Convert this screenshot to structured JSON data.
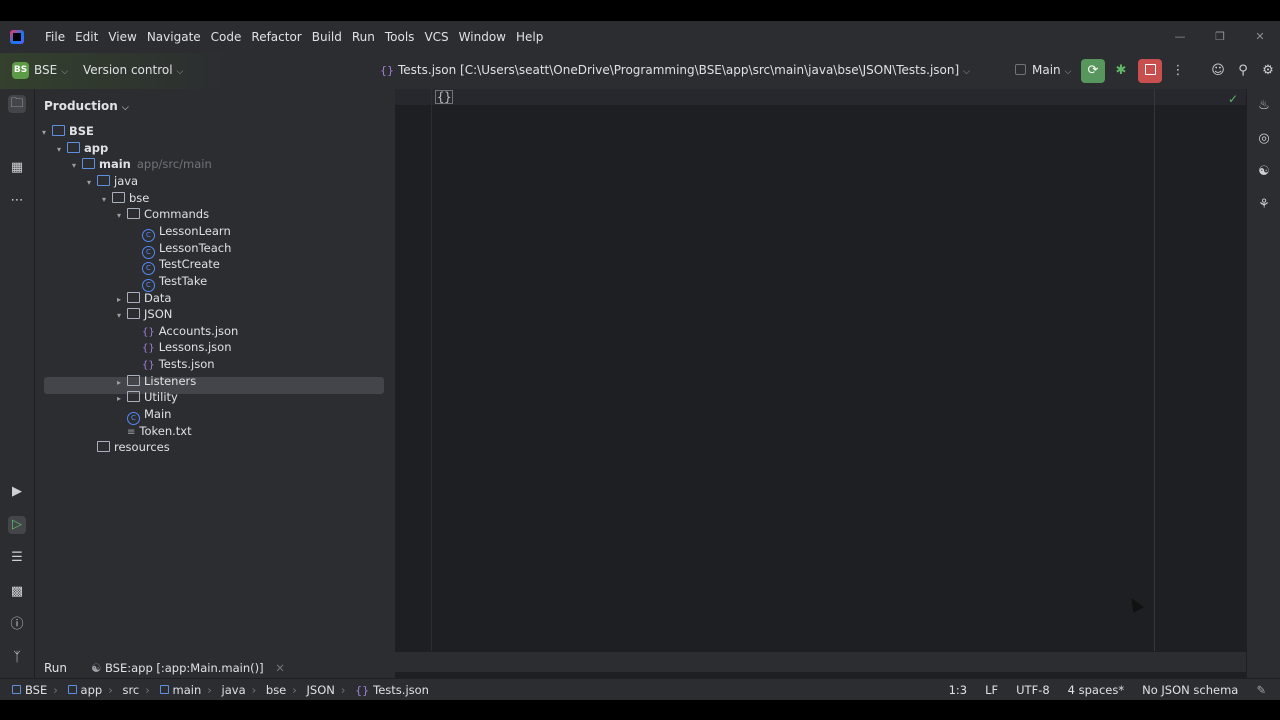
{
  "menu": [
    "File",
    "Edit",
    "View",
    "Navigate",
    "Code",
    "Refactor",
    "Build",
    "Run",
    "Tools",
    "VCS",
    "Window",
    "Help"
  ],
  "toolbar": {
    "project_badge": "BS",
    "project_name": "BSE",
    "vcs_label": "Version control",
    "file_title": "Tests.json [C:\\Users\\seatt\\OneDrive\\Programming\\BSE\\app\\src\\main\\java\\bse\\JSON\\Tests.json]",
    "run_config": "Main"
  },
  "panel": {
    "title": "Production"
  },
  "tree": [
    {
      "label": "BSE",
      "hint": "",
      "icon": "module-folder",
      "indent": 0,
      "arrow": "down",
      "bold": true
    },
    {
      "label": "app",
      "hint": "",
      "icon": "module-folder",
      "indent": 1,
      "arrow": "down",
      "bold": true
    },
    {
      "label": "main",
      "hint": "app/src/main",
      "icon": "module-folder",
      "indent": 2,
      "arrow": "down",
      "bold": true
    },
    {
      "label": "java",
      "hint": "",
      "icon": "source-folder",
      "indent": 3,
      "arrow": "down",
      "bold": false
    },
    {
      "label": "bse",
      "hint": "",
      "icon": "package",
      "indent": 4,
      "arrow": "down",
      "bold": false
    },
    {
      "label": "Commands",
      "hint": "",
      "icon": "package",
      "indent": 5,
      "arrow": "down",
      "bold": false
    },
    {
      "label": "LessonLearn",
      "hint": "",
      "icon": "class",
      "indent": 6,
      "arrow": "",
      "bold": false
    },
    {
      "label": "LessonTeach",
      "hint": "",
      "icon": "class",
      "indent": 6,
      "arrow": "",
      "bold": false
    },
    {
      "label": "TestCreate",
      "hint": "",
      "icon": "class",
      "indent": 6,
      "arrow": "",
      "bold": false
    },
    {
      "label": "TestTake",
      "hint": "",
      "icon": "class",
      "indent": 6,
      "arrow": "",
      "bold": false
    },
    {
      "label": "Data",
      "hint": "",
      "icon": "package",
      "indent": 5,
      "arrow": "right",
      "bold": false
    },
    {
      "label": "JSON",
      "hint": "",
      "icon": "package",
      "indent": 5,
      "arrow": "down",
      "bold": false
    },
    {
      "label": "Accounts.json",
      "hint": "",
      "icon": "json",
      "indent": 6,
      "arrow": "",
      "bold": false
    },
    {
      "label": "Lessons.json",
      "hint": "",
      "icon": "json",
      "indent": 6,
      "arrow": "",
      "bold": false
    },
    {
      "label": "Tests.json",
      "hint": "",
      "icon": "json",
      "indent": 6,
      "arrow": "",
      "bold": false
    },
    {
      "label": "Listeners",
      "hint": "",
      "icon": "package",
      "indent": 5,
      "arrow": "right",
      "bold": false
    },
    {
      "label": "Utility",
      "hint": "",
      "icon": "package",
      "indent": 5,
      "arrow": "right",
      "bold": false
    },
    {
      "label": "Main",
      "hint": "",
      "icon": "class",
      "indent": 5,
      "arrow": "",
      "bold": false
    },
    {
      "label": "Token.txt",
      "hint": "",
      "icon": "text",
      "indent": 5,
      "arrow": "",
      "bold": false
    },
    {
      "label": "resources",
      "hint": "",
      "icon": "resources-folder",
      "indent": 3,
      "arrow": "",
      "bold": false
    }
  ],
  "editor": {
    "content": "{}"
  },
  "run": {
    "label": "Run",
    "tab": "BSE:app [:app:Main.main()]"
  },
  "breadcrumb": [
    "BSE",
    "app",
    "src",
    "main",
    "java",
    "bse",
    "JSON",
    "Tests.json"
  ],
  "status": {
    "position": "1:3",
    "line_sep": "LF",
    "encoding": "UTF-8",
    "indent": "4 spaces*",
    "schema": "No JSON schema"
  }
}
